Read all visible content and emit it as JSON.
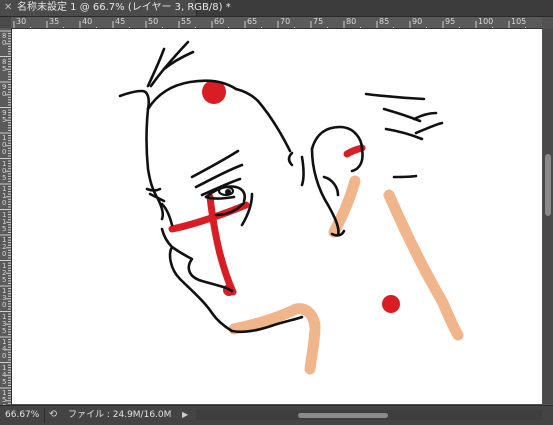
{
  "document_tab": {
    "close_icon": "close-icon",
    "title": "名称未設定 1 @ 66.7% (レイヤー 3, RGB/8) *"
  },
  "rulers": {
    "horizontal_labels": [
      "30",
      "35",
      "40",
      "45",
      "50",
      "55",
      "60",
      "65",
      "70",
      "75",
      "80",
      "85",
      "90",
      "95",
      "100",
      "105"
    ],
    "vertical_labels": [
      "80",
      "85",
      "90",
      "95",
      "100",
      "105",
      "110",
      "115",
      "120",
      "125",
      "130",
      "135",
      "140",
      "145",
      "150"
    ]
  },
  "status_bar": {
    "zoom": "66.67%",
    "share_icon": "share-icon",
    "file_info": "ファイル : 24.9M/16.0M",
    "menu_arrow": "▶"
  },
  "colors": {
    "ink": "#111111",
    "red": "#d81e24",
    "skin": "#f0b58a"
  }
}
